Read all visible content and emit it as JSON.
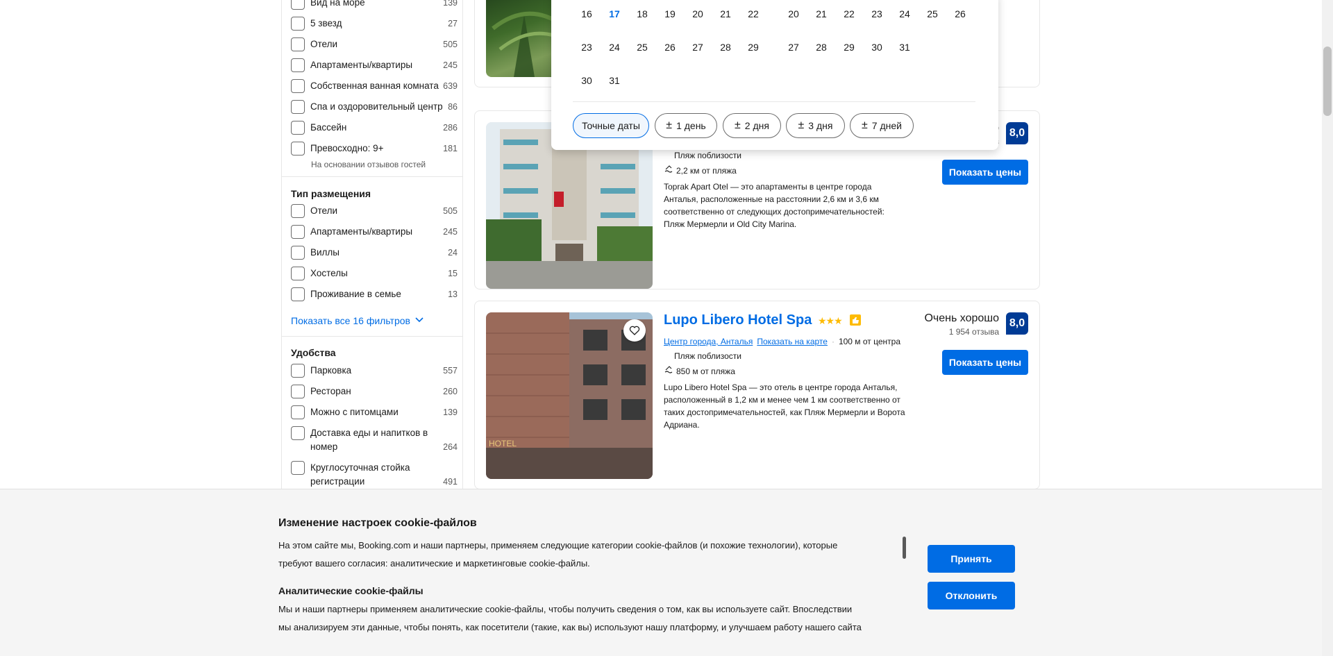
{
  "filters": {
    "popular": [
      {
        "label": "Вид на море",
        "count": "139"
      },
      {
        "label": "5 звезд",
        "count": "27"
      },
      {
        "label": "Отели",
        "count": "505"
      },
      {
        "label": "Апартаменты/квартиры",
        "count": "245"
      },
      {
        "label": "Собственная ванная комната",
        "count": "639"
      },
      {
        "label": "Спа и оздоровительный центр",
        "count": "86"
      },
      {
        "label": "Бассейн",
        "count": "286"
      },
      {
        "label": "Превосходно: 9+",
        "count": "181",
        "sub": "На основании отзывов гостей"
      }
    ],
    "accommodation": {
      "title": "Тип размещения",
      "items": [
        {
          "label": "Отели",
          "count": "505"
        },
        {
          "label": "Апартаменты/квартиры",
          "count": "245"
        },
        {
          "label": "Виллы",
          "count": "24"
        },
        {
          "label": "Хостелы",
          "count": "15"
        },
        {
          "label": "Проживание в семье",
          "count": "13"
        }
      ],
      "show_all": "Показать все 16 фильтров"
    },
    "amenities": {
      "title": "Удобства",
      "items": [
        {
          "label": "Парковка",
          "count": "557"
        },
        {
          "label": "Ресторан",
          "count": "260"
        },
        {
          "label": "Можно с питомцами",
          "count": "139"
        },
        {
          "label": "Доставка еды и напитков в номер",
          "count": "264"
        },
        {
          "label": "Круглосуточная стойка регистрации",
          "count": "491"
        }
      ]
    }
  },
  "calendar": {
    "left_rows": [
      [
        "16",
        "17",
        "18",
        "19",
        "20",
        "21",
        "22"
      ],
      [
        "23",
        "24",
        "25",
        "26",
        "27",
        "28",
        "29"
      ],
      [
        "30",
        "31"
      ]
    ],
    "right_rows": [
      [
        "20",
        "21",
        "22",
        "23",
        "24",
        "25",
        "26"
      ],
      [
        "27",
        "28",
        "29",
        "30",
        "31"
      ]
    ],
    "today": "17",
    "chips": [
      "Точные даты",
      "1 день",
      "2 дня",
      "3 дня",
      "7 дней"
    ],
    "chip_symbol": "±"
  },
  "cards": {
    "toprak": {
      "rating_partial": "о",
      "rating_count_partial": "в",
      "score": "8,0",
      "beach_nearby": "Пляж поблизости",
      "beach_distance": "2,2 км от пляжа",
      "description": "Toprak Apart Otel — это апартаменты в центре города Анталья, расположенные на расстоянии 2,6 км и 3,6 км соответственно от следующих достопримечательностей: Пляж Мермерли и Old City Marina.",
      "button": "Показать цены"
    },
    "lupo": {
      "name": "Lupo Libero Hotel Spa",
      "stars": "★★★",
      "district": "Центр города, Анталья",
      "map_link": "Показать на карте",
      "center_distance": "100 м от центра",
      "beach_nearby": "Пляж поблизости",
      "beach_distance": "850 м от пляжа",
      "description": "Lupo Libero Hotel Spa — это отель в центре города Анталья, расположенный в 1,2 км и менее чем 1 км соответственно от таких достопримечательностей, как Пляж Мермерли и Ворота Адриана.",
      "rating_word": "Очень хорошо",
      "rating_count": "1 954 отзыва",
      "score": "8,0",
      "button": "Показать цены"
    }
  },
  "cookie": {
    "title": "Изменение настроек cookie-файлов",
    "line1": "На этом сайте мы, Booking.com и наши партнеры, применяем следующие категории cookie-файлов (и похожие технологии), которые",
    "line2": "требуют вашего согласия: аналитические и маркетинговые cookie-файлы.",
    "analytics_title": "Аналитические cookie-файлы",
    "line3": "Мы и наши партнеры применяем аналитические cookie-файлы, чтобы получить сведения о том, как вы используете сайт. Впоследствии",
    "line4": "мы анализируем эти данные, чтобы понять, как посетители (такие, как вы) используют нашу платформу, и улучшаем работу нашего сайта",
    "accept": "Принять",
    "decline": "Отклонить"
  }
}
